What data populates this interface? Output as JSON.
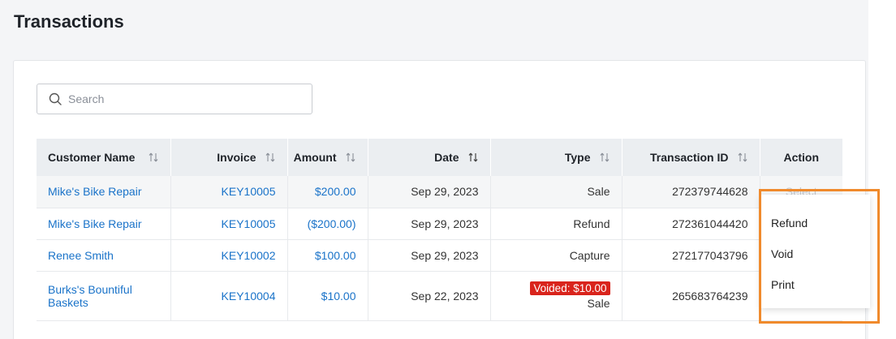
{
  "page": {
    "title": "Transactions"
  },
  "search": {
    "placeholder": "Search",
    "value": ""
  },
  "table": {
    "columns": [
      {
        "label": "Customer Name",
        "sortable": true
      },
      {
        "label": "Invoice",
        "sortable": true
      },
      {
        "label": "Amount",
        "sortable": true
      },
      {
        "label": "Date",
        "sortable": true
      },
      {
        "label": "Type",
        "sortable": true
      },
      {
        "label": "Transaction ID",
        "sortable": true
      },
      {
        "label": "Action",
        "sortable": false
      }
    ],
    "rows": [
      {
        "customer": "Mike's Bike Repair",
        "invoice": "KEY10005",
        "amount": "$200.00",
        "date": "Sep 29, 2023",
        "type": "Sale",
        "badge": "",
        "txn_id": "272379744628",
        "action": "Select"
      },
      {
        "customer": "Mike's Bike Repair",
        "invoice": "KEY10005",
        "amount": "($200.00)",
        "date": "Sep 29, 2023",
        "type": "Refund",
        "badge": "",
        "txn_id": "272361044420",
        "action": ""
      },
      {
        "customer": "Renee Smith",
        "invoice": "KEY10002",
        "amount": "$100.00",
        "date": "Sep 29, 2023",
        "type": "Capture",
        "badge": "",
        "txn_id": "272177043796",
        "action": ""
      },
      {
        "customer": "Burks's Bountiful Baskets",
        "invoice": "KEY10004",
        "amount": "$10.00",
        "date": "Sep 22, 2023",
        "type": "Sale",
        "badge": "Voided: $10.00",
        "txn_id": "265683764239",
        "action": ""
      }
    ]
  },
  "action_menu": {
    "items": [
      "Refund",
      "Void",
      "Print"
    ]
  },
  "colors": {
    "link": "#1a73c9",
    "badge_bg": "#d9241c",
    "highlight": "#f08a2c",
    "header_bg": "#ebeef1"
  },
  "icons": {
    "search": "search-icon",
    "sort": "sort-arrows-icon"
  }
}
